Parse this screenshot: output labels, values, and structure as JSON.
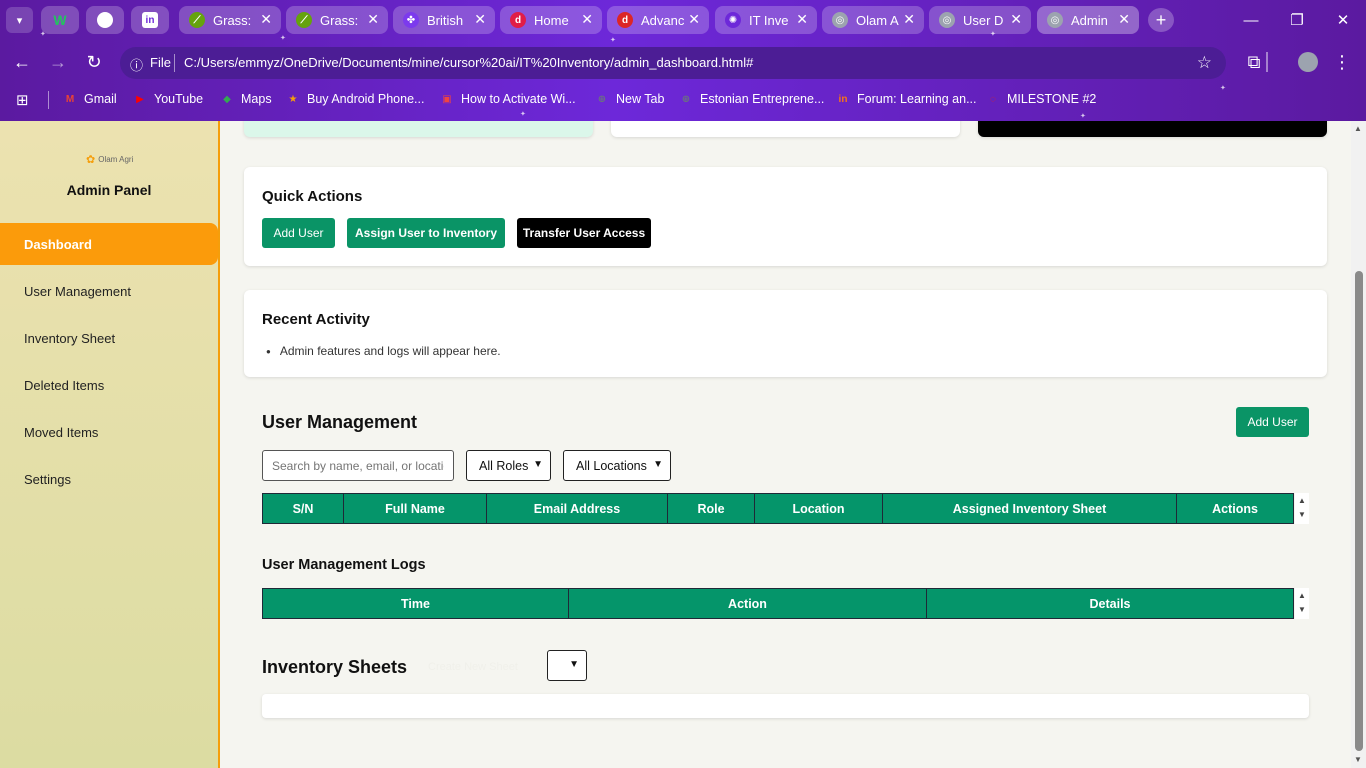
{
  "browser": {
    "tabs": [
      {
        "label": "Grass:",
        "color": "#65a30d",
        "glyph": "⟋"
      },
      {
        "label": "Grass:",
        "color": "#65a30d",
        "glyph": "⟋"
      },
      {
        "label": "British",
        "color": "#7c3aed",
        "glyph": "✤"
      },
      {
        "label": "Home",
        "color": "#e11d48",
        "glyph": "d"
      },
      {
        "label": "Advanc",
        "color": "#dc2626",
        "glyph": "d"
      },
      {
        "label": "IT Inve",
        "color": "#6d28d9",
        "glyph": "✺"
      },
      {
        "label": "Olam A",
        "color": "#9ca3af",
        "glyph": "◎"
      },
      {
        "label": "User D",
        "color": "#9ca3af",
        "glyph": "◎"
      },
      {
        "label": "Admin",
        "color": "#9ca3af",
        "glyph": "◎"
      }
    ],
    "close_glyph": "✕",
    "new_tab_glyph": "+",
    "address": {
      "scheme_label": "File",
      "url": "C:/Users/emmyz/OneDrive/Documents/mine/cursor%20ai/IT%20Inventory/admin_dashboard.html#"
    },
    "bookmarks": [
      {
        "label": "Gmail",
        "icon": "M",
        "color": "#ea4335"
      },
      {
        "label": "YouTube",
        "icon": "▶",
        "color": "#ff0000"
      },
      {
        "label": "Maps",
        "icon": "◆",
        "color": "#34a853"
      },
      {
        "label": "Buy Android Phone...",
        "icon": "★",
        "color": "#f59e0b"
      },
      {
        "label": "How to Activate Wi...",
        "icon": "▣",
        "color": "#ef4444"
      },
      {
        "label": "New Tab",
        "icon": "⊕",
        "color": "#6b7280"
      },
      {
        "label": "Estonian Entreprene...",
        "icon": "⊕",
        "color": "#6b7280"
      },
      {
        "label": "Forum: Learning an...",
        "icon": "in",
        "color": "#f97316"
      },
      {
        "label": "MILESTONE #2",
        "icon": "◌",
        "color": "#dc2626"
      }
    ]
  },
  "sidebar": {
    "logo_text": "Olam Agri",
    "title": "Admin Panel",
    "items": [
      {
        "label": "Dashboard",
        "active": true
      },
      {
        "label": "User Management",
        "active": false
      },
      {
        "label": "Inventory Sheet",
        "active": false
      },
      {
        "label": "Deleted Items",
        "active": false
      },
      {
        "label": "Moved Items",
        "active": false
      },
      {
        "label": "Settings",
        "active": false
      }
    ]
  },
  "quick_actions": {
    "title": "Quick Actions",
    "add_user": "Add User",
    "assign_user": "Assign User to Inventory",
    "transfer_access": "Transfer User Access"
  },
  "recent_activity": {
    "title": "Recent Activity",
    "items": [
      "Admin features and logs will appear here."
    ]
  },
  "user_management": {
    "title": "User Management",
    "add_user": "Add User",
    "search_placeholder": "Search by name, email, or location",
    "role_filter": "All Roles",
    "location_filter": "All Locations",
    "columns": [
      "S/N",
      "Full Name",
      "Email Address",
      "Role",
      "Location",
      "Assigned Inventory Sheet",
      "Actions"
    ]
  },
  "logs": {
    "title": "User Management Logs",
    "columns": [
      "Time",
      "Action",
      "Details"
    ]
  },
  "inventory_sheets": {
    "title": "Inventory Sheets",
    "create_button": "Create New Sheet"
  },
  "colors": {
    "accent_green": "#05956a",
    "sidebar_active": "#fb9b0b",
    "chrome_purple": "#6b21a8"
  }
}
